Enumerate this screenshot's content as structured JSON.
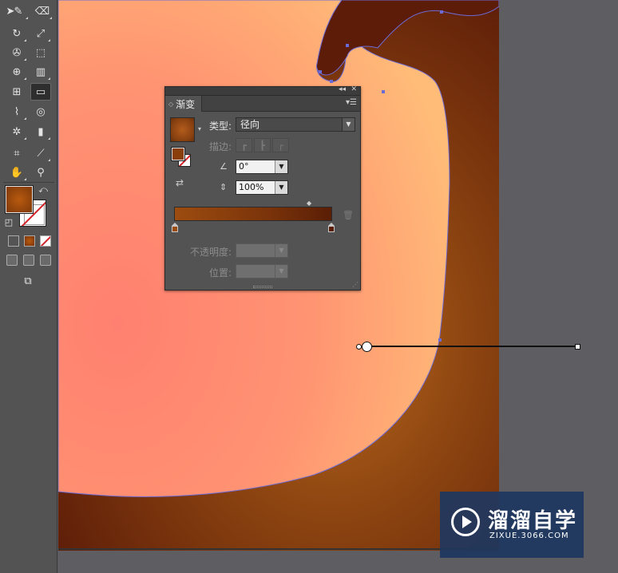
{
  "toolbar": {
    "tools": [
      {
        "name": "selection-tool-icon",
        "glyph": "➤"
      },
      {
        "name": "pencil-tool-icon",
        "glyph": "✎"
      },
      {
        "name": "eraser-tool-icon",
        "glyph": "⌫"
      },
      {
        "name": "rotate-tool-icon",
        "glyph": "↻"
      },
      {
        "name": "scale-tool-icon",
        "glyph": "⤢"
      },
      {
        "name": "warp-tool-icon",
        "glyph": "✇"
      },
      {
        "name": "free-transform-tool-icon",
        "glyph": "⬚"
      },
      {
        "name": "shape-builder-tool-icon",
        "glyph": "⊕"
      },
      {
        "name": "graph-tool-icon",
        "glyph": "▥"
      },
      {
        "name": "mesh-tool-icon",
        "glyph": "⊞"
      },
      {
        "name": "gradient-tool-icon",
        "glyph": "▭"
      },
      {
        "name": "eyedropper-tool-icon",
        "glyph": "⌇"
      },
      {
        "name": "blend-tool-icon",
        "glyph": "◎"
      },
      {
        "name": "symbol-sprayer-tool-icon",
        "glyph": "✲"
      },
      {
        "name": "column-graph-tool-icon",
        "glyph": "▮"
      },
      {
        "name": "artboard-tool-icon",
        "glyph": "⌗"
      },
      {
        "name": "slice-tool-icon",
        "glyph": "⟋"
      },
      {
        "name": "hand-tool-icon",
        "glyph": "✋"
      },
      {
        "name": "zoom-tool-icon",
        "glyph": "⚲"
      }
    ],
    "swap_glyph": "⤺",
    "default_glyph": "◰",
    "draw_mode_glyph": "⧉"
  },
  "panel": {
    "collapse_glyph": "◂◂",
    "close_glyph": "✕",
    "tab_arrows": "◇",
    "tab_label": "渐变",
    "menu_glyph": "▾☰",
    "thumb_arrow": "▾",
    "reverse_glyph": "⇄",
    "type_label": "类型:",
    "type_value": "径向",
    "stroke_label": "描边:",
    "angle_glyph": "∠",
    "angle_value": "0°",
    "aspect_glyph": "⇕",
    "aspect_value": "100%",
    "midpoint_glyph": "◆",
    "trash_glyph": "🗑",
    "opacity_label": "不透明度:",
    "location_label": "位置:",
    "resize_glyph": "⋰",
    "dropdown_glyph": "▼",
    "stroke_buttons": [
      "┏",
      "┣",
      "┌"
    ]
  },
  "colors": {
    "gradient_start": "#9c4c0f",
    "gradient_end": "#5a1e06",
    "fill": "#8a3f0a",
    "artwork_light": "#ff8c6a",
    "artwork_dark": "#5c1c08"
  },
  "watermark": {
    "title": "溜溜自学",
    "subtitle": "ZIXUE.3066.COM"
  }
}
